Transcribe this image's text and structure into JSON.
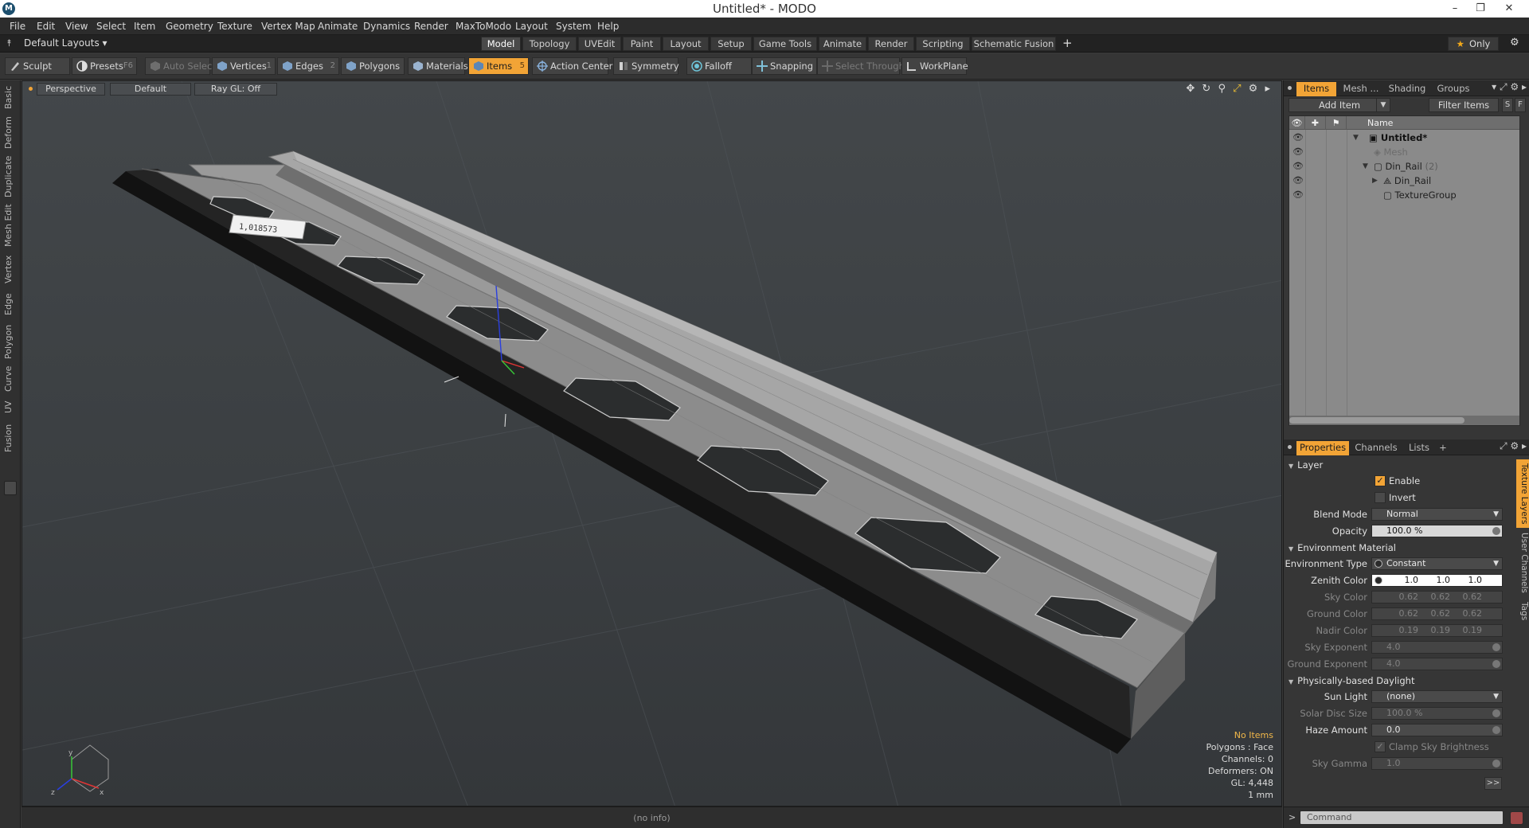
{
  "window": {
    "title": "Untitled* - MODO",
    "min": "–",
    "max": "❐",
    "close": "✕"
  },
  "menu": [
    "File",
    "Edit",
    "View",
    "Select",
    "Item",
    "Geometry",
    "Texture",
    "Vertex Map",
    "Animate",
    "Dynamics",
    "Render",
    "MaxToModo",
    "Layout",
    "System",
    "Help"
  ],
  "layout_bar": {
    "layouts_label": "Default Layouts ▾",
    "tabs": [
      "Model",
      "Topology",
      "UVEdit",
      "Paint",
      "Layout",
      "Setup",
      "Game Tools",
      "Animate",
      "Render",
      "Scripting",
      "Schematic Fusion"
    ],
    "active_tab": "Model",
    "only_label": "Only"
  },
  "toolbar": {
    "sculpt": "Sculpt",
    "presets": "Presets",
    "presets_key": "F6",
    "auto_select": "Auto Select",
    "vertices": "Vertices",
    "vertices_key": "1",
    "edges": "Edges",
    "edges_key": "2",
    "polygons": "Polygons",
    "polygons_key": "3",
    "materials": "Materials",
    "items": "Items",
    "items_key": "5",
    "action_center": "Action Center",
    "symmetry": "Symmetry",
    "falloff": "Falloff",
    "snapping": "Snapping",
    "select_through": "Select Through",
    "workplane": "WorkPlane"
  },
  "left_tabs": [
    "Basic",
    "Deform",
    "Duplicate",
    "Mesh Edit",
    "Vertex",
    "Edge",
    "Polygon",
    "Curve",
    "UV",
    "Fusion"
  ],
  "viewport": {
    "view": "Perspective",
    "style": "Default",
    "raygl": "Ray GL: Off",
    "label_text": "1,018573",
    "status": {
      "items": "No Items",
      "polygons": "Polygons : Face",
      "channels": "Channels: 0",
      "deformers": "Deformers: ON",
      "gl": "GL: 4,448",
      "unit": "1 mm"
    },
    "info": "(no info)"
  },
  "items_panel": {
    "tabs": [
      "Items",
      "Mesh ...",
      "Shading",
      "Groups"
    ],
    "active_tab": "Items",
    "add_item": "Add Item",
    "filter_items": "Filter Items",
    "s_btn": "S",
    "f_btn": "F",
    "name_header": "Name",
    "tree": [
      {
        "label": "Untitled*",
        "style": "bold"
      },
      {
        "label": "Mesh",
        "style": "dim"
      },
      {
        "label": "Din_Rail",
        "count": "(2)"
      },
      {
        "label": "Din_Rail"
      },
      {
        "label": "TextureGroup"
      }
    ]
  },
  "properties": {
    "tabs": [
      "Properties",
      "Channels",
      "Lists"
    ],
    "active_tab": "Properties",
    "vtabs": [
      "Texture Layers",
      "User Channels",
      "Tags"
    ],
    "layer": {
      "title": "Layer",
      "enable": "Enable",
      "invert": "Invert",
      "blend_mode_label": "Blend Mode",
      "blend_mode": "Normal",
      "opacity_label": "Opacity",
      "opacity": "100.0 %"
    },
    "environment": {
      "title": "Environment Material",
      "type_label": "Environment Type",
      "type": "Constant",
      "zenith_label": "Zenith Color",
      "zenith": [
        "1.0",
        "1.0",
        "1.0"
      ],
      "sky_label": "Sky Color",
      "sky": [
        "0.62",
        "0.62",
        "0.62"
      ],
      "ground_label": "Ground Color",
      "ground": [
        "0.62",
        "0.62",
        "0.62"
      ],
      "nadir_label": "Nadir Color",
      "nadir": [
        "0.19",
        "0.19",
        "0.19"
      ],
      "sky_exp_label": "Sky Exponent",
      "sky_exp": "4.0",
      "ground_exp_label": "Ground Exponent",
      "ground_exp": "4.0"
    },
    "daylight": {
      "title": "Physically-based Daylight",
      "sun_light_label": "Sun Light",
      "sun_light": "(none)",
      "solar_disc_label": "Solar Disc Size",
      "solar_disc": "100.0 %",
      "haze_label": "Haze Amount",
      "haze": "0.0",
      "clamp": "Clamp Sky Brightness",
      "sky_gamma_label": "Sky Gamma",
      "sky_gamma": "1.0"
    },
    "more": ">>"
  },
  "command": {
    "prompt": ">",
    "placeholder": "Command"
  },
  "colors": {
    "accent": "#f2a436",
    "panel": "#363636",
    "viewport": "#3e4245"
  }
}
